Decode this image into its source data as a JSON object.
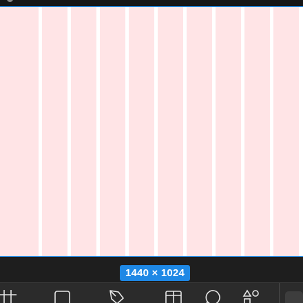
{
  "frame": {
    "background": "#ffffff",
    "selection_color": "#1e88e5",
    "layout_grid": {
      "type": "columns",
      "color": "#ffe4e6"
    }
  },
  "dimensions_badge": {
    "label": "1440 × 1024"
  },
  "toolbar": {
    "tools": [
      {
        "name": "frame-tool",
        "icon": "hash-frame-icon"
      },
      {
        "name": "rectangle-tool",
        "icon": "rectangle-icon"
      },
      {
        "name": "pen-tool",
        "icon": "pen-icon"
      },
      {
        "name": "layout-tool",
        "icon": "layout-icon"
      },
      {
        "name": "comment-tool",
        "icon": "comment-icon"
      },
      {
        "name": "actions-tool",
        "icon": "shapes-icon"
      }
    ]
  }
}
